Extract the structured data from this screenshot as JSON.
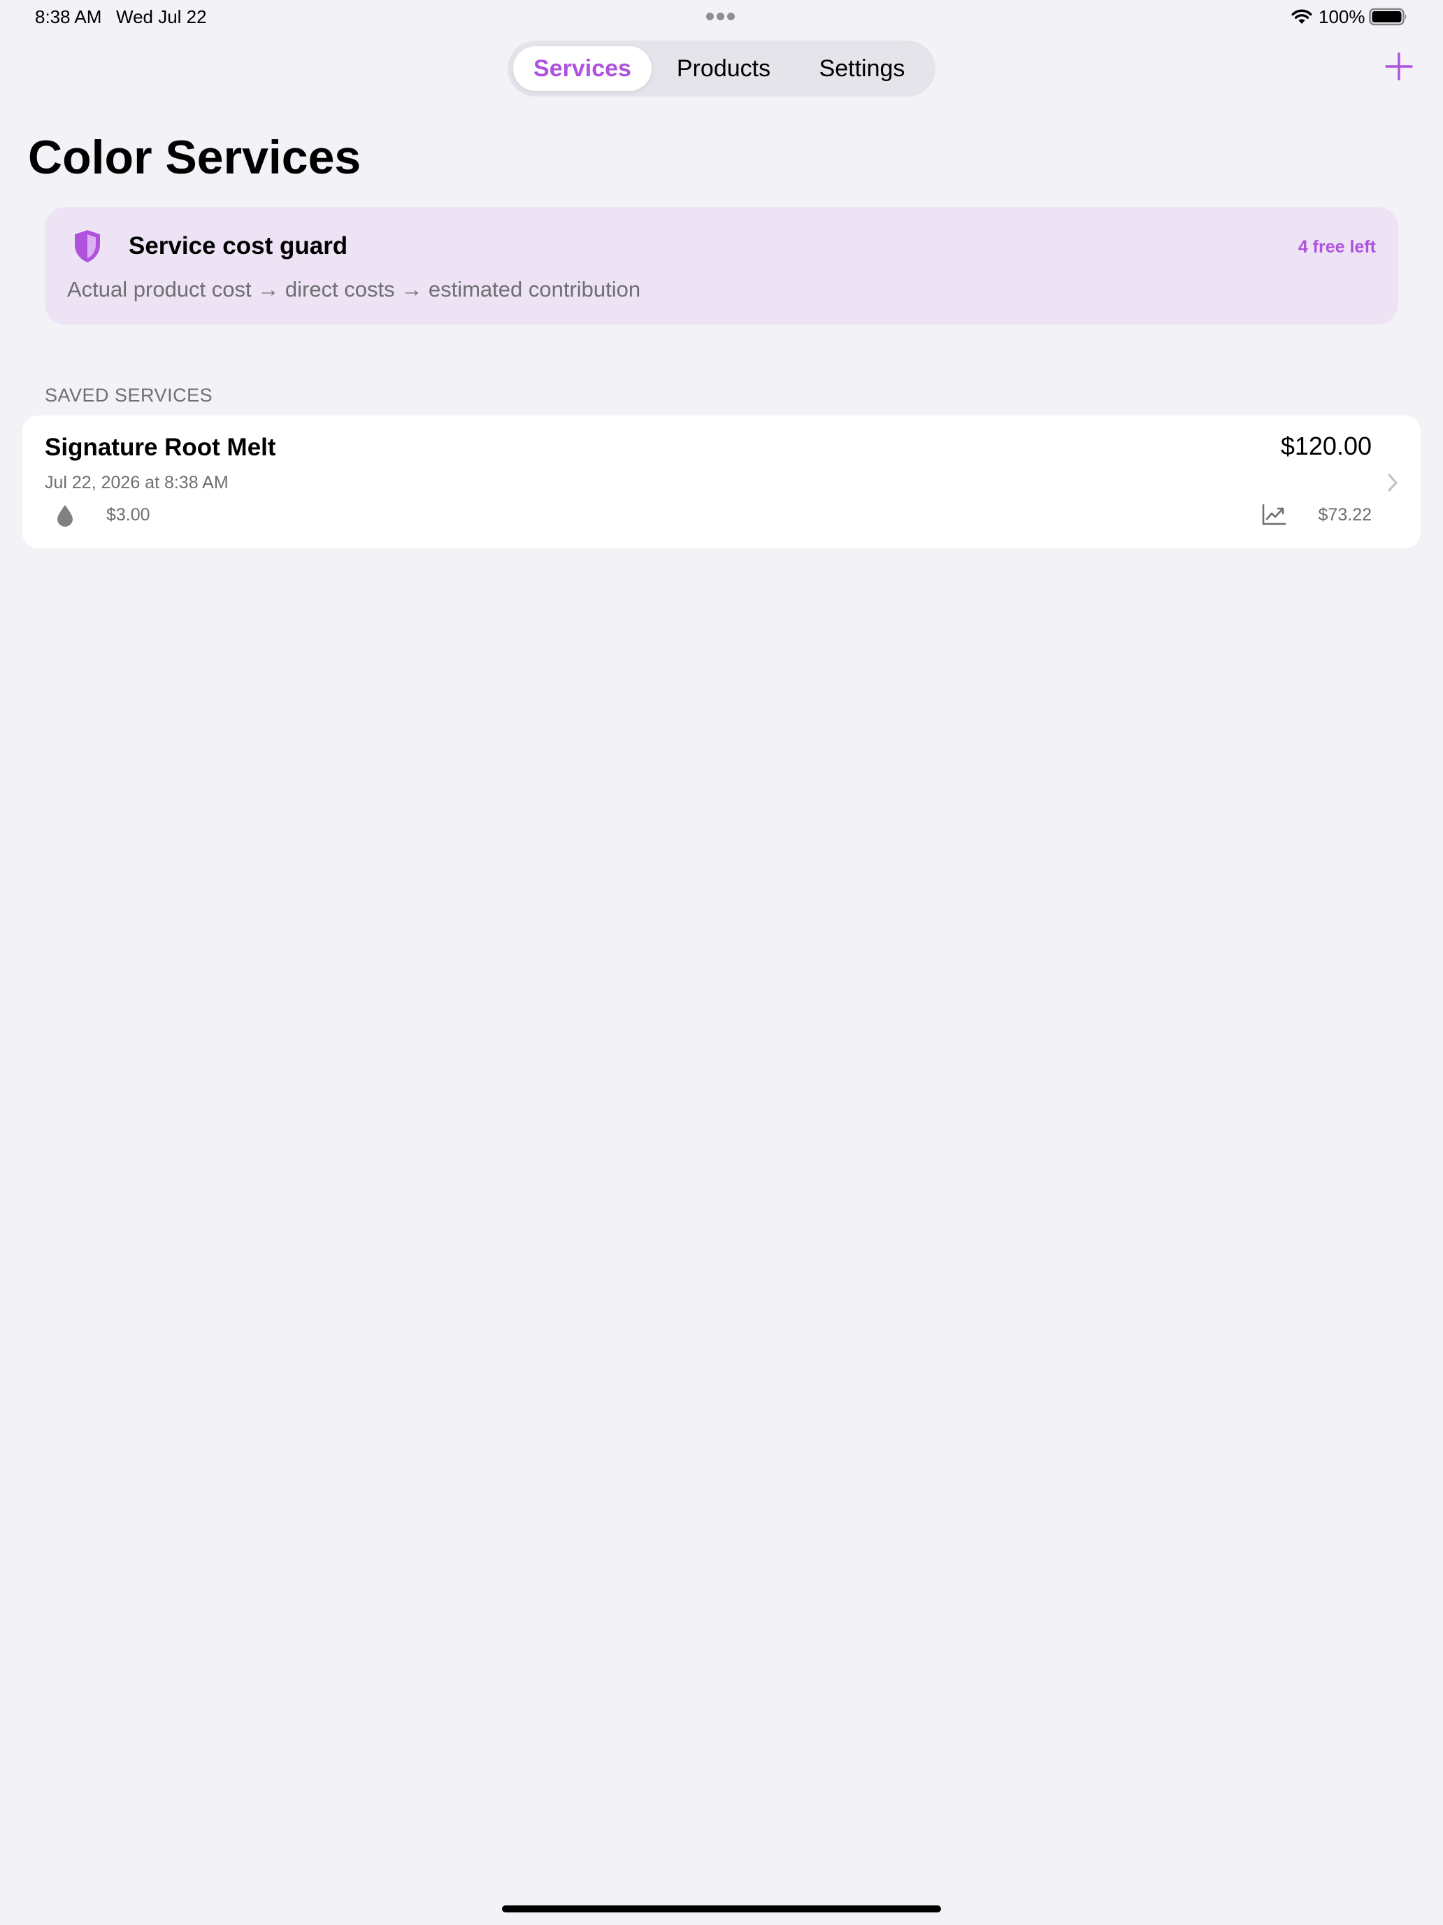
{
  "status_bar": {
    "time": "8:38 AM",
    "date": "Wed Jul 22",
    "battery_percent": "100%",
    "icons": [
      "multitask-dots-icon",
      "wifi-icon",
      "battery-icon"
    ]
  },
  "nav": {
    "tabs": [
      {
        "label": "Services",
        "selected": true
      },
      {
        "label": "Products",
        "selected": false
      },
      {
        "label": "Settings",
        "selected": false
      }
    ],
    "add_icon": "plus-icon"
  },
  "page": {
    "title": "Color Services"
  },
  "guard_card": {
    "icon": "shield-icon",
    "title": "Service cost guard",
    "badge": "4 free left",
    "subtitle": "Actual product cost → direct costs → estimated contribution"
  },
  "saved_services": {
    "header": "SAVED SERVICES",
    "items": [
      {
        "name": "Signature Root Melt",
        "price": "$120.00",
        "date": "Jul 22, 2026 at 8:38 AM",
        "product_cost": "$3.00",
        "contribution": "$73.22",
        "icons": [
          "drop-icon",
          "trend-icon",
          "chevron-right-icon"
        ]
      }
    ]
  },
  "colors": {
    "accent": "#af52de",
    "background": "#f2f2f7",
    "card_tint": "#ede3f4",
    "secondary_text": "#6e6e73"
  }
}
